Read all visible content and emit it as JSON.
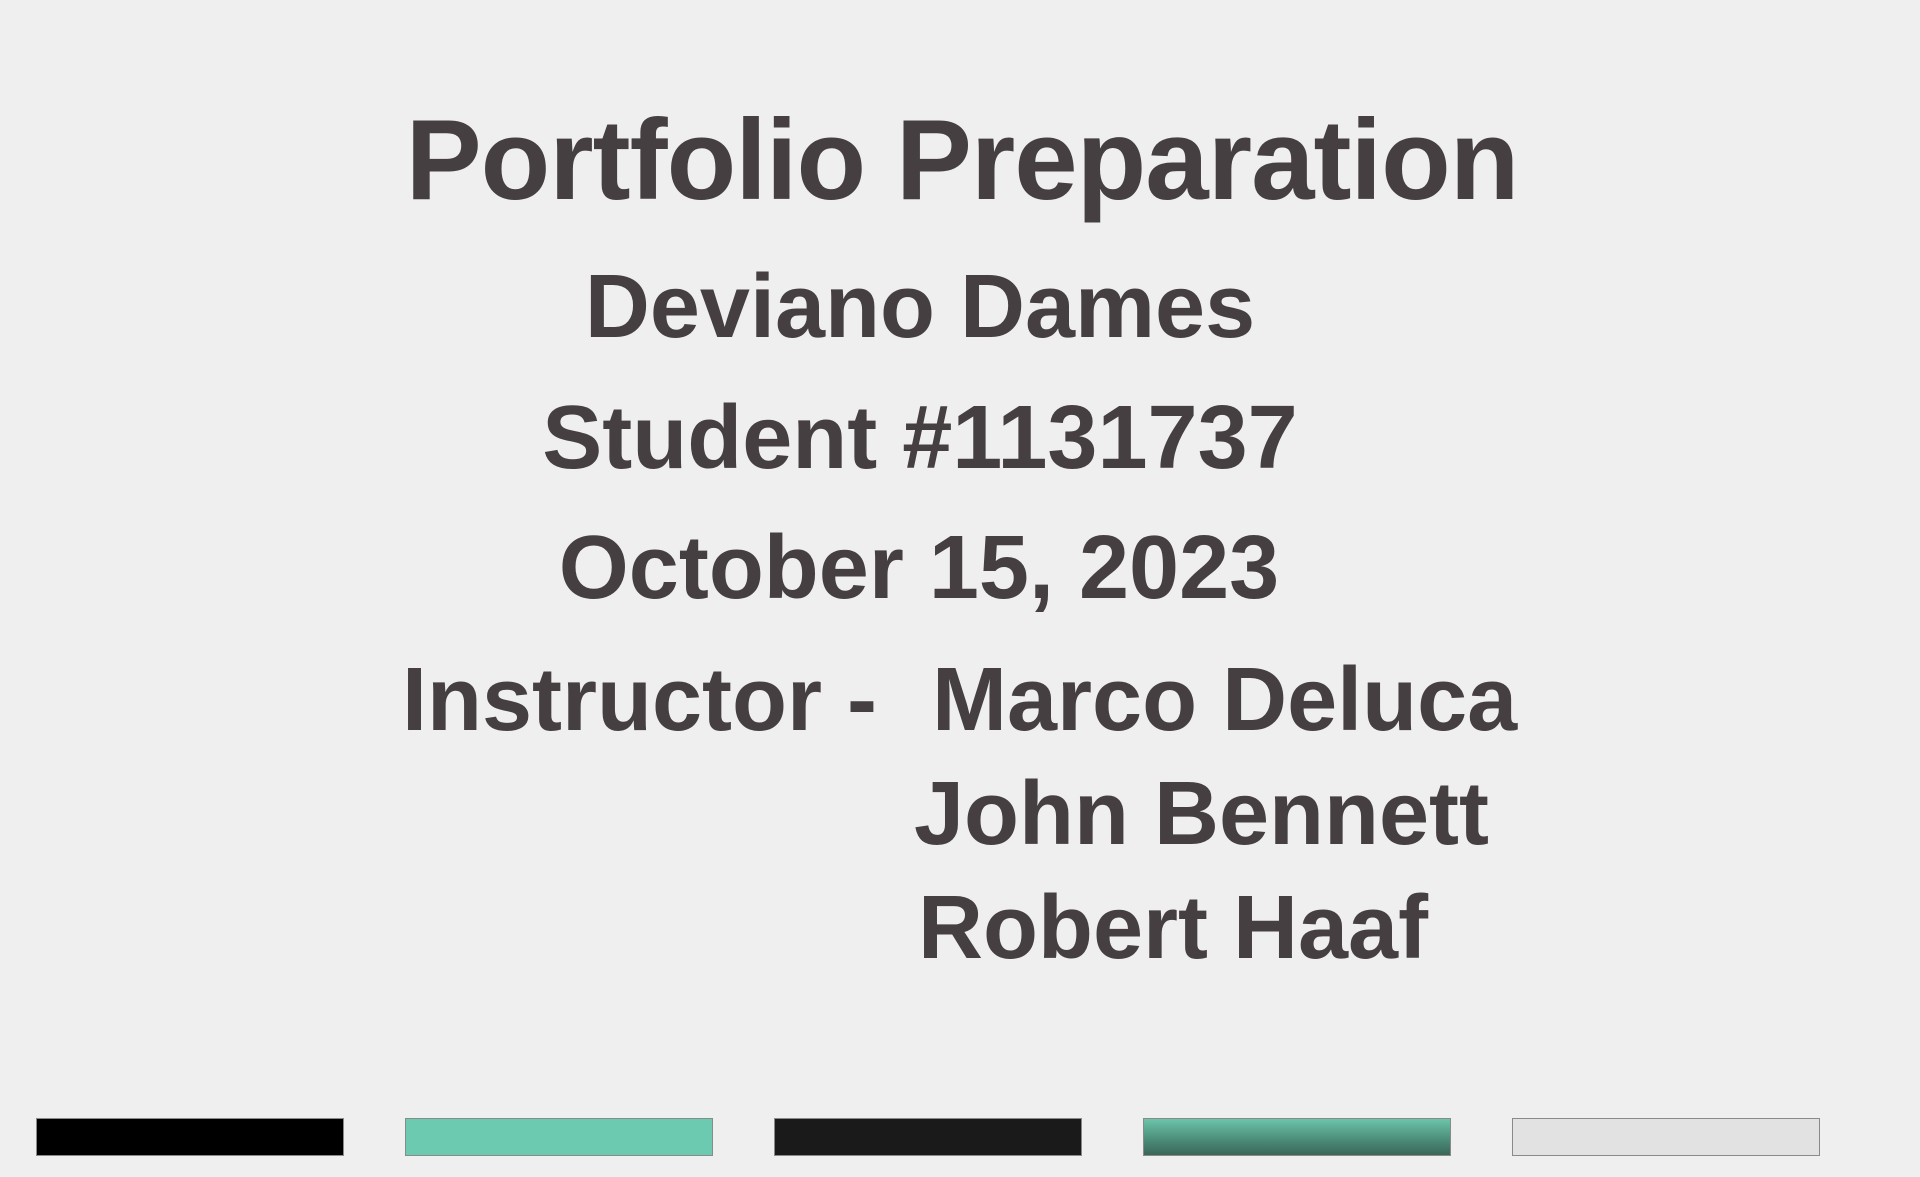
{
  "slide": {
    "title": "Portfolio Preparation",
    "author_name": "Deviano Dames",
    "student_number": "Student #1131737",
    "date": "October 15, 2023",
    "instructor_label": "Instructor -",
    "instructors": [
      "Marco Deluca",
      "John Bennett",
      "Robert Haaf"
    ]
  },
  "colors": {
    "background": "#efefef",
    "text": "#463f42",
    "swatches": [
      "#000000",
      "#6ccab0",
      "#1a1a1a",
      "#4a8a76",
      "#e2e2e2"
    ]
  }
}
